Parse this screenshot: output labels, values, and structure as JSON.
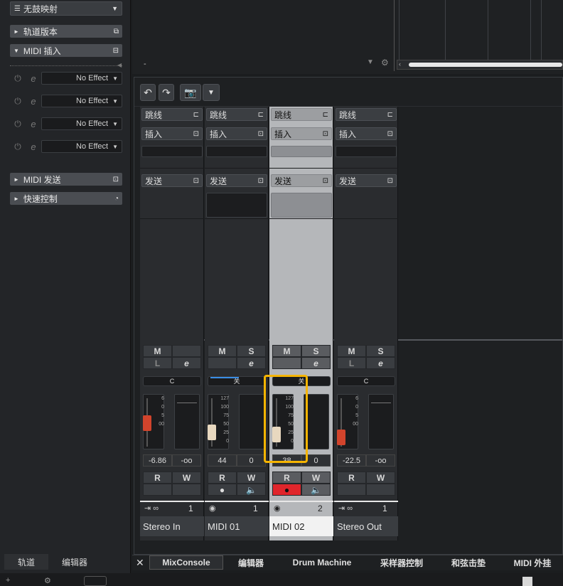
{
  "inspector": {
    "mapping_value": "无鼓映射",
    "sections": {
      "track_versions": "轨道版本",
      "midi_inserts": "MIDI 插入",
      "midi_sends": "MIDI 发送",
      "quick_controls": "快速控制"
    },
    "insert_slots": [
      "No Effect",
      "No Effect",
      "No Effect",
      "No Effect"
    ],
    "bottom_tabs": [
      "轨道",
      "编辑器"
    ]
  },
  "top": {
    "dash": "-"
  },
  "mixer": {
    "rack_labels": {
      "routing": "跳线",
      "inserts": "插入",
      "sends": "发送"
    },
    "channels": [
      {
        "name": "Stereo In",
        "number": "1",
        "m": "M",
        "s": "",
        "l": "L",
        "pan": "C",
        "volume": "-6.86",
        "peak": "-oo",
        "scale": [
          "6",
          "0",
          "5",
          "",
          "",
          "",
          "",
          "00"
        ],
        "r": "R",
        "w": "W",
        "cap_color": "#d2442c",
        "fader_level": 0.55
      },
      {
        "name": "MIDI 01",
        "number": "1",
        "m": "M",
        "s": "S",
        "l": "",
        "pan": "关",
        "volume": "44",
        "peak": "0",
        "scale": [
          "127",
          "100",
          "75",
          "50",
          "25",
          "0"
        ],
        "r": "R",
        "w": "W",
        "cap_color": "#e8d8bf",
        "fader_level": 0.35
      },
      {
        "name": "MIDI 02",
        "number": "2",
        "m": "M",
        "s": "S",
        "l": "",
        "pan": "关",
        "volume": "38",
        "peak": "0",
        "scale": [
          "127",
          "100",
          "75",
          "50",
          "25",
          "0"
        ],
        "r": "R",
        "w": "W",
        "cap_color": "#e8d8bf",
        "fader_level": 0.3
      },
      {
        "name": "Stereo Out",
        "number": "1",
        "m": "M",
        "s": "S",
        "l": "L",
        "pan": "C",
        "volume": "-22.5",
        "peak": "-oo",
        "scale": [
          "6",
          "0",
          "5",
          "",
          "",
          "",
          "",
          "00"
        ],
        "r": "R",
        "w": "W",
        "cap_color": "#d2442c",
        "fader_level": 0.25
      }
    ]
  },
  "zone_tabs": [
    "MixConsole",
    "编辑器",
    "Drum Machine",
    "采样器控制",
    "和弦击垫",
    "MIDI 外挂"
  ],
  "colors": {
    "highlight": "#f5b400",
    "record_active": "#e0252b"
  }
}
